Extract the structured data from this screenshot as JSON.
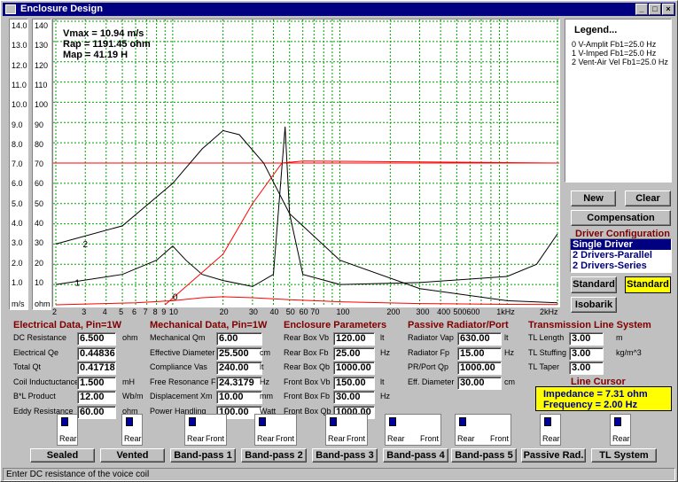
{
  "window": {
    "title": "Enclosure Design",
    "min": "_",
    "max": "□",
    "close": "×"
  },
  "y_axis_left": {
    "ticks": [
      "14.0",
      "13.0",
      "12.0",
      "11.0",
      "10.0",
      "9.0",
      "8.0",
      "7.0",
      "6.0",
      "5.0",
      "4.0",
      "3.0",
      "2.0",
      "1.0"
    ],
    "unit": "m/s"
  },
  "y_axis_right": {
    "ticks": [
      "140",
      "130",
      "120",
      "110",
      "100",
      "90",
      "80",
      "70",
      "60",
      "50",
      "40",
      "30",
      "20",
      "10"
    ],
    "unit": "ohm"
  },
  "x_axis": {
    "ticks": [
      "2",
      "3",
      "4",
      "5",
      "6",
      "7",
      "8",
      "9",
      "10",
      "20",
      "30",
      "40",
      "50",
      "60",
      "70",
      "100",
      "200",
      "300",
      "400",
      "500",
      "600",
      "1kHz",
      "2kHz"
    ]
  },
  "readout": {
    "vmax": "Vmax = 10.94 m/s",
    "rap": "Rap = 1191.45 ohm",
    "map": "Map = 41.19 H"
  },
  "curve_labels": {
    "c0": "0",
    "c1": "1",
    "c2": "2"
  },
  "chart_data": {
    "type": "line",
    "xlabel": "",
    "ylabel": "",
    "xscale": "log",
    "xlim": [
      2,
      2000
    ],
    "ylim": [
      0,
      140
    ],
    "series": [
      {
        "values": [
          [
            2,
            0
          ],
          [
            6,
            1
          ],
          [
            10,
            2
          ],
          [
            15,
            3.5
          ],
          [
            20,
            4
          ],
          [
            30,
            3.5
          ],
          [
            50,
            2.5
          ],
          [
            100,
            1.5
          ],
          [
            300,
            0.6
          ],
          [
            1000,
            0.2
          ],
          [
            2000,
            0.1
          ]
        ]
      },
      {
        "values": [
          [
            2,
            10
          ],
          [
            5,
            15
          ],
          [
            8,
            22
          ],
          [
            10,
            29
          ],
          [
            12,
            22
          ],
          [
            15,
            15
          ],
          [
            20,
            12
          ],
          [
            30,
            9
          ],
          [
            40,
            15
          ],
          [
            47,
            88
          ],
          [
            50,
            45
          ],
          [
            60,
            15
          ],
          [
            100,
            10
          ],
          [
            300,
            11
          ],
          [
            1000,
            14
          ],
          [
            1500,
            20
          ],
          [
            2000,
            35
          ]
        ]
      },
      {
        "values": [
          [
            2,
            30
          ],
          [
            5,
            39
          ],
          [
            10,
            60
          ],
          [
            15,
            77
          ],
          [
            20,
            86
          ],
          [
            25,
            84
          ],
          [
            35,
            70
          ],
          [
            50,
            45
          ],
          [
            100,
            22
          ],
          [
            300,
            8
          ],
          [
            1000,
            2
          ],
          [
            2000,
            1
          ]
        ]
      }
    ]
  },
  "legend": {
    "title": "Legend...",
    "items": [
      "0 V-Amplit Fb1=25.0 Hz",
      "1 V-Imped Fb1=25.0 Hz",
      "2 Vent-Air Vel Fb1=25.0 Hz"
    ]
  },
  "buttons": {
    "new": "New",
    "clear": "Clear",
    "compensation": "Compensation",
    "isobarik": "Isobarik",
    "std1": "Standard",
    "std2": "Standard"
  },
  "driver_config": {
    "title": "Driver Configuration",
    "options": [
      "Single Driver",
      "2 Drivers-Parallel",
      "2 Drivers-Series"
    ]
  },
  "electrical": {
    "title": "Electrical Data, Pin=1W",
    "rows": [
      {
        "label": "DC Resistance",
        "value": "6.500",
        "unit": "ohm"
      },
      {
        "label": "Electrical Qe",
        "value": "0.44836",
        "unit": ""
      },
      {
        "label": "Total Qt",
        "value": "0.41718",
        "unit": ""
      },
      {
        "label": "Coil Inductuctance",
        "value": "1.500",
        "unit": "mH"
      },
      {
        "label": "B*L Product",
        "value": "12.00",
        "unit": "Wb/m"
      },
      {
        "label": "Eddy Resistance",
        "value": "60.00",
        "unit": "ohm"
      }
    ]
  },
  "mechanical": {
    "title": "Mechanical Data, Pin=1W",
    "rows": [
      {
        "label": "Mechanical Qm",
        "value": "6.00",
        "unit": ""
      },
      {
        "label": "Effective Diameter",
        "value": "25.500",
        "unit": "cm"
      },
      {
        "label": "Compliance Vas",
        "value": "240.00",
        "unit": "lt"
      },
      {
        "label": "Free Resonance Fs",
        "value": "24.3179",
        "unit": "Hz"
      },
      {
        "label": "Displacement Xm",
        "value": "10.00",
        "unit": "mm"
      },
      {
        "label": "Power Handling",
        "value": "100.00",
        "unit": "Watt"
      }
    ]
  },
  "enclosure": {
    "title": "Enclosure Parameters",
    "rows": [
      {
        "label": "Rear Box Vb",
        "value": "120.00",
        "unit": "lt"
      },
      {
        "label": "Rear Box Fb",
        "value": "25.00",
        "unit": "Hz"
      },
      {
        "label": "Rear Box Qb",
        "value": "1000.00",
        "unit": ""
      },
      {
        "label": "Front Box Vb",
        "value": "150.00",
        "unit": "lt"
      },
      {
        "label": "Front Box Fb",
        "value": "30.00",
        "unit": "Hz"
      },
      {
        "label": "Front Box Qb",
        "value": "1000.00",
        "unit": ""
      }
    ]
  },
  "passive": {
    "title": "Passive Radiator/Port",
    "rows": [
      {
        "label": "Radiator Vap",
        "value": "630.00",
        "unit": "lt"
      },
      {
        "label": "Radiator Fp",
        "value": "15.00",
        "unit": "Hz"
      },
      {
        "label": "PR/Port Qp",
        "value": "1000.00",
        "unit": ""
      },
      {
        "label": "Eff. Diameter",
        "value": "30.00",
        "unit": "cm"
      }
    ]
  },
  "tl": {
    "title": "Transmission Line System",
    "rows": [
      {
        "label": "TL Length",
        "value": "3.00",
        "unit": "m"
      },
      {
        "label": "TL Stuffing",
        "value": "3.00",
        "unit": "kg/m^3"
      },
      {
        "label": "TL Taper",
        "value": "3.00",
        "unit": ""
      }
    ]
  },
  "line_cursor": {
    "title": "Line Cursor",
    "impedance": "Impedance = 7.31 ohm",
    "frequency": "Frequency = 2.00 Hz"
  },
  "enclosure_types": {
    "labels": [
      "Sealed",
      "Vented",
      "Band-pass 1",
      "Band-pass 2",
      "Band-pass 3",
      "Band-pass 4",
      "Band-pass 5",
      "Passive Rad.",
      "TL System"
    ],
    "rear": "Rear",
    "front": "Front"
  },
  "status": "Enter DC resistance of the voice coil",
  "colors": {
    "title_bg": "#000080",
    "header": "#800000",
    "accent_yellow": "#ffff00",
    "curve_red": "#ff0000",
    "curve_black": "#000000",
    "grid": "#00a000"
  }
}
